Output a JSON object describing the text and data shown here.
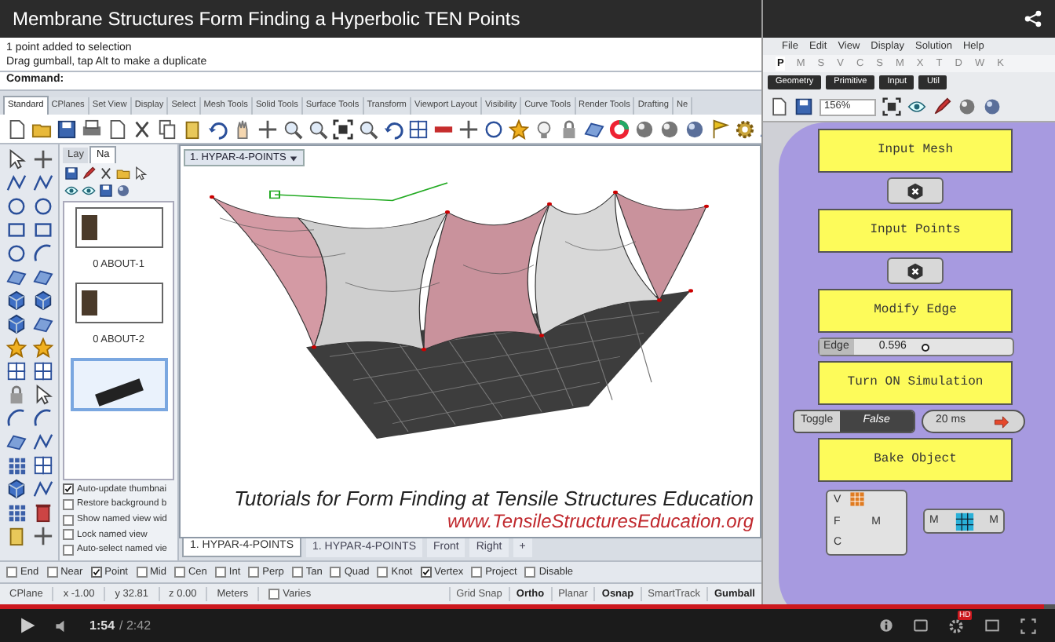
{
  "video_title": "Membrane Structures Form Finding a Hyperbolic TEN Points",
  "rhino": {
    "messages": [
      "1 point added to selection",
      "Drag gumball, tap Alt to make a duplicate"
    ],
    "command_label": "Command:",
    "toolbar_tabs": [
      {
        "label": "Standard",
        "selected": true
      },
      {
        "label": "CPlanes",
        "selected": false
      },
      {
        "label": "Set View",
        "selected": false
      },
      {
        "label": "Display",
        "selected": false
      },
      {
        "label": "Select",
        "selected": false
      },
      {
        "label": "Mesh Tools",
        "selected": false
      },
      {
        "label": "Solid Tools",
        "selected": false
      },
      {
        "label": "Surface Tools",
        "selected": false
      },
      {
        "label": "Transform",
        "selected": false
      },
      {
        "label": "Viewport Layout",
        "selected": false
      },
      {
        "label": "Visibility",
        "selected": false
      },
      {
        "label": "Curve Tools",
        "selected": false
      },
      {
        "label": "Render Tools",
        "selected": false
      },
      {
        "label": "Drafting",
        "selected": false
      },
      {
        "label": "Ne",
        "selected": false
      }
    ],
    "panel_tabs": [
      {
        "label": "Lay",
        "selected": false
      },
      {
        "label": "Na",
        "selected": true
      }
    ],
    "named_views": [
      {
        "label": "0 ABOUT-1",
        "selected": false
      },
      {
        "label": "0 ABOUT-2",
        "selected": false
      },
      {
        "selected": true
      }
    ],
    "view_options": [
      {
        "label": "Auto-update thumbnai",
        "checked": true
      },
      {
        "label": "Restore background b",
        "checked": false
      },
      {
        "label": "Show named view wid",
        "checked": false
      },
      {
        "label": "Lock named view",
        "checked": false
      },
      {
        "label": "Auto-select named vie",
        "checked": false
      }
    ],
    "viewport_title": "1. HYPAR-4-POINTS",
    "caption": "Tutorials for Form Finding  at Tensile Structures Education",
    "url": "www.TensileStructuresEducation.org",
    "viewport_tabs": [
      {
        "label": "1. HYPAR-4-POINTS",
        "selected": true
      },
      {
        "label": "1. HYPAR-4-POINTS",
        "selected": false
      },
      {
        "label": "Front",
        "selected": false
      },
      {
        "label": "Right",
        "selected": false
      },
      {
        "label": "+",
        "selected": false
      }
    ],
    "osnaps": [
      {
        "label": "End",
        "checked": false
      },
      {
        "label": "Near",
        "checked": false
      },
      {
        "label": "Point",
        "checked": true
      },
      {
        "label": "Mid",
        "checked": false
      },
      {
        "label": "Cen",
        "checked": false
      },
      {
        "label": "Int",
        "checked": false
      },
      {
        "label": "Perp",
        "checked": false
      },
      {
        "label": "Tan",
        "checked": false
      },
      {
        "label": "Quad",
        "checked": false
      },
      {
        "label": "Knot",
        "checked": false
      },
      {
        "label": "Vertex",
        "checked": true
      },
      {
        "label": "Project",
        "checked": false
      },
      {
        "label": "Disable",
        "checked": false
      }
    ],
    "coordinates": [
      "CPlane",
      "x -1.00",
      "y 32.81",
      "z 0.00",
      "Meters"
    ],
    "varies": {
      "label": "Varies",
      "checked": false
    },
    "modes": [
      {
        "label": "Grid Snap",
        "on": false
      },
      {
        "label": "Ortho",
        "on": true
      },
      {
        "label": "Planar",
        "on": false
      },
      {
        "label": "Osnap",
        "on": true
      },
      {
        "label": "SmartTrack",
        "on": false
      },
      {
        "label": "Gumball",
        "on": true
      }
    ]
  },
  "grasshopper": {
    "menu": [
      "File",
      "Edit",
      "View",
      "Display",
      "Solution",
      "Help"
    ],
    "tabs": [
      {
        "label": "P",
        "selected": true
      },
      {
        "label": "M",
        "selected": false
      },
      {
        "label": "S",
        "selected": false
      },
      {
        "label": "V",
        "selected": false
      },
      {
        "label": "C",
        "selected": false
      },
      {
        "label": "S",
        "selected": false
      },
      {
        "label": "M",
        "selected": false
      },
      {
        "label": "X",
        "selected": false
      },
      {
        "label": "T",
        "selected": false
      },
      {
        "label": "D",
        "selected": false
      },
      {
        "label": "W",
        "selected": false
      },
      {
        "label": "K",
        "selected": false
      }
    ],
    "categories": [
      "Geometry",
      "Primitive",
      "Input",
      "Util"
    ],
    "zoom": "156%",
    "nodes": [
      {
        "kind": "panel",
        "label": "Input Mesh"
      },
      {
        "kind": "component"
      },
      {
        "kind": "panel",
        "label": "Input Points"
      },
      {
        "kind": "component"
      },
      {
        "kind": "panel",
        "label": "Modify Edge"
      },
      {
        "kind": "slider",
        "label": "Edge",
        "value": "0.596",
        "level": 0.55
      },
      {
        "kind": "panel",
        "label": "Turn ON Simulation"
      },
      {
        "kind": "toggle",
        "label": "Toggle",
        "value": "False",
        "timer": "20 ms"
      },
      {
        "kind": "panel",
        "label": "Bake Object"
      },
      {
        "kind": "mesh",
        "inputs": [
          "V",
          "F",
          "C"
        ],
        "output": "M",
        "next_input": "M",
        "next_output": "M"
      }
    ]
  },
  "player": {
    "time": "1:54",
    "duration": "/ 2:42",
    "level": 0.99,
    "badge": "HD"
  }
}
